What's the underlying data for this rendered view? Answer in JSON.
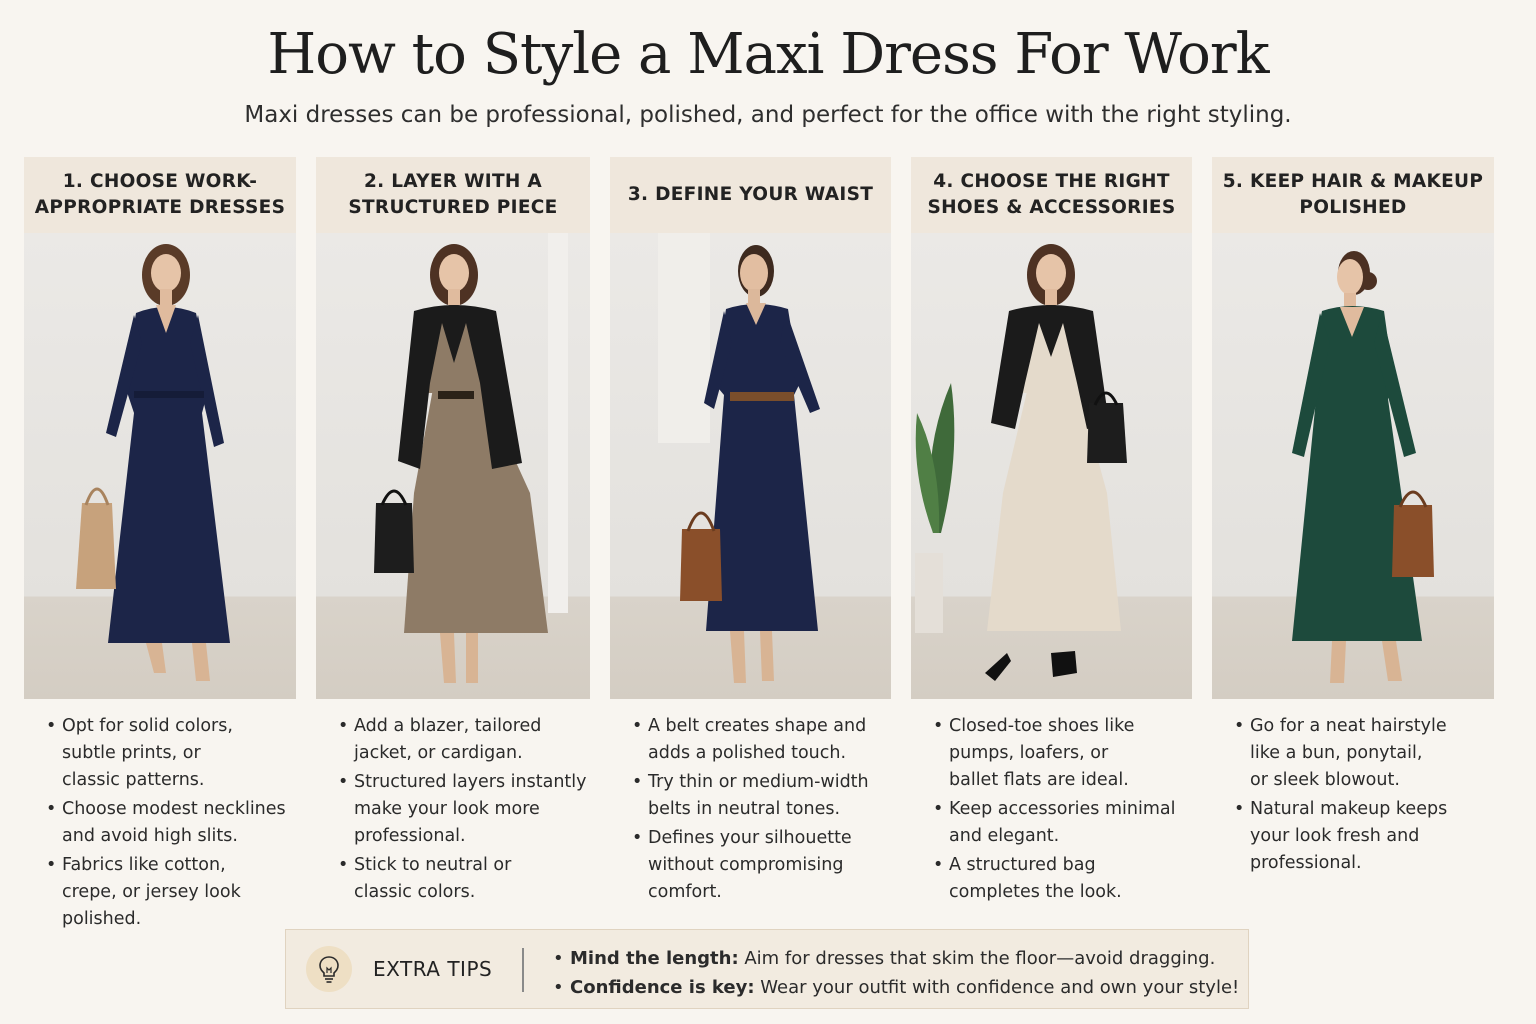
{
  "title": "How to Style a Maxi Dress For Work",
  "subtitle": "Maxi dresses can be professional, polished, and perfect for the office with the right styling.",
  "steps": [
    {
      "heading_lines": [
        "1. CHOOSE WORK-",
        "APPROPRIATE DRESSES"
      ],
      "tips": [
        [
          "Opt for solid colors,",
          "subtle prints, or",
          "classic patterns."
        ],
        [
          "Choose modest necklines",
          "and avoid high slits."
        ],
        [
          "Fabrics like cotton,",
          "crepe, or jersey look",
          "polished."
        ]
      ]
    },
    {
      "heading_lines": [
        "2. LAYER WITH A",
        "STRUCTURED PIECE"
      ],
      "tips": [
        [
          "Add a blazer, tailored",
          "jacket, or cardigan."
        ],
        [
          "Structured layers instantly",
          "make your look more",
          "professional."
        ],
        [
          "Stick to neutral or",
          "classic colors."
        ]
      ]
    },
    {
      "heading_lines": [
        "3. DEFINE YOUR WAIST"
      ],
      "tips": [
        [
          "A belt creates shape and",
          "adds a polished touch."
        ],
        [
          "Try thin or medium-width",
          "belts in neutral tones."
        ],
        [
          "Defines your silhouette",
          "without compromising",
          "comfort."
        ]
      ]
    },
    {
      "heading_lines": [
        "4. CHOOSE THE RIGHT",
        "SHOES & ACCESSORIES"
      ],
      "tips": [
        [
          "Closed-toe shoes like",
          "pumps, loafers, or",
          "ballet flats are ideal."
        ],
        [
          "Keep accessories minimal",
          "and elegant."
        ],
        [
          "A structured bag",
          "completes the look."
        ]
      ]
    },
    {
      "heading_lines": [
        "5. KEEP HAIR & MAKEUP",
        "POLISHED"
      ],
      "tips": [
        [
          "Go for a neat hairstyle",
          "like a bun, ponytail,",
          "or sleek blowout."
        ],
        [
          "Natural makeup keeps",
          "your look fresh and",
          "professional."
        ]
      ]
    }
  ],
  "extra_tips": {
    "label": "EXTRA TIPS",
    "icon": "lightbulb-icon",
    "items": [
      {
        "bold": "Mind the length:",
        "text": " Aim for dresses that skim the floor—avoid dragging."
      },
      {
        "bold": "Confidence is key:",
        "text": " Wear your outfit with confidence and own your style!"
      }
    ]
  },
  "colors": {
    "background": "#f8f5f0",
    "header_band": "#efe7dc",
    "navy_dress": "#1c2548",
    "green_dress": "#1d4a3c",
    "blazer": "#1b1b1b",
    "tan_bag": "#c7a27c",
    "brown_bag": "#8a4f2a"
  }
}
